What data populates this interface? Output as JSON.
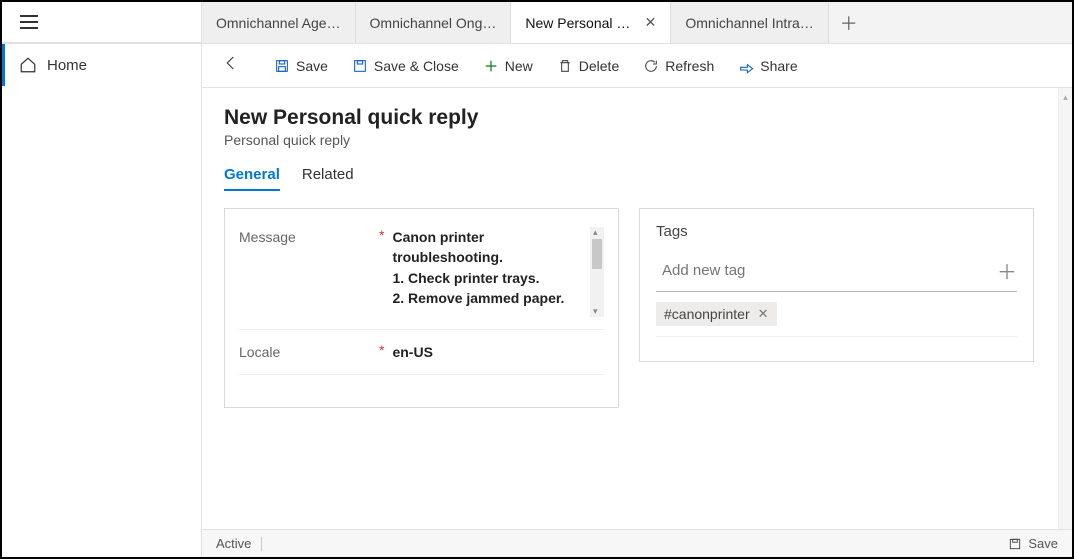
{
  "sidebar": {
    "home_label": "Home"
  },
  "tabs": [
    {
      "label": "Omnichannel Age…"
    },
    {
      "label": "Omnichannel Ong…"
    },
    {
      "label": "New Personal quick reply",
      "active": true,
      "closeable": true
    },
    {
      "label": "Omnichannel Intra…"
    }
  ],
  "commands": {
    "save": "Save",
    "save_close": "Save & Close",
    "new": "New",
    "delete": "Delete",
    "refresh": "Refresh",
    "share": "Share"
  },
  "page": {
    "title": "New Personal quick reply",
    "subtitle": "Personal quick reply"
  },
  "form_tabs": {
    "general": "General",
    "related": "Related"
  },
  "fields": {
    "message_label": "Message",
    "message_value": "Canon printer troubleshooting.\n1. Check printer trays.\n2. Remove jammed paper.",
    "locale_label": "Locale",
    "locale_value": "en-US"
  },
  "tags_section": {
    "title": "Tags",
    "placeholder": "Add new tag",
    "chips": [
      "#canonprinter"
    ]
  },
  "statusbar": {
    "state": "Active",
    "save": "Save"
  }
}
